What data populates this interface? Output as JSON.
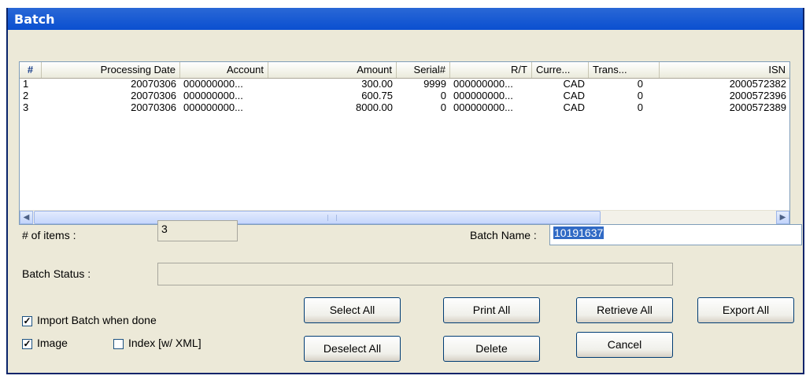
{
  "window": {
    "title": "Batch"
  },
  "list": {
    "columns": [
      "#",
      "Processing Date",
      "Account",
      "Amount",
      "Serial#",
      "R/T",
      "Curre...",
      "Trans...",
      "ISN"
    ],
    "rows": [
      [
        "1",
        "20070306",
        "000000000...",
        "300.00",
        "9999",
        "000000000...",
        "CAD",
        "0",
        "2000572382"
      ],
      [
        "2",
        "20070306",
        "000000000...",
        "600.75",
        "0",
        "000000000...",
        "CAD",
        "0",
        "2000572396"
      ],
      [
        "3",
        "20070306",
        "000000000...",
        "8000.00",
        "0",
        "000000000...",
        "CAD",
        "0",
        "2000572389"
      ]
    ],
    "scroll_left_icon": "arrow-left-icon",
    "scroll_right_icon": "arrow-right-icon"
  },
  "form": {
    "items_label": "# of items :",
    "items_value": "3",
    "batch_name_label": "Batch Name :",
    "batch_name_value": "10191637",
    "batch_status_label": "Batch Status :",
    "batch_status_value": ""
  },
  "options": {
    "import_batch": {
      "label": "Import Batch when done",
      "checked": true
    },
    "image": {
      "label": "Image",
      "checked": true
    },
    "index_xml": {
      "label": "Index [w/ XML]",
      "checked": false
    }
  },
  "buttons": {
    "select_all": "Select All",
    "print_all": "Print All",
    "retrieve_all": "Retrieve All",
    "export_all": "Export All",
    "deselect_all": "Deselect All",
    "delete": "Delete",
    "cancel": "Cancel"
  },
  "colors": {
    "title_bar": "#0a4fd0",
    "selection": "#316ac5"
  }
}
